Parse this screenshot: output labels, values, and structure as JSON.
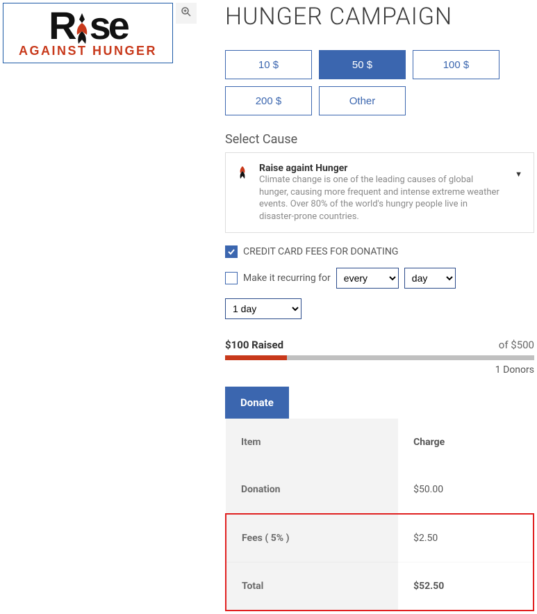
{
  "logo": {
    "word_prefix": "R",
    "word_suffix": "se",
    "tagline": "AGAINST HUNGER"
  },
  "title": "HUNGER CAMPAIGN",
  "amounts": [
    {
      "label": "10 $",
      "selected": false
    },
    {
      "label": "50 $",
      "selected": true
    },
    {
      "label": "100 $",
      "selected": false
    },
    {
      "label": "200 $",
      "selected": false
    },
    {
      "label": "Other",
      "selected": false
    }
  ],
  "cause": {
    "section_label": "Select Cause",
    "title": "Raise againt Hunger",
    "description": "Climate change is one of the leading causes of global hunger, causing more frequent and intense extreme weather events. Over 80% of the world's hungry people live in disaster-prone countries."
  },
  "options": {
    "cc_fees_label": "CREDIT CARD FEES FOR DONATING",
    "cc_fees_checked": true,
    "recurring_label": "Make it recurring for",
    "recurring_checked": false,
    "freq_options": [
      "every"
    ],
    "unit_options": [
      "day"
    ],
    "period_options": [
      "1 day"
    ]
  },
  "progress": {
    "raised_label": "$100 Raised",
    "goal_label": "of $500",
    "percent": 20,
    "donors_label": "1 Donors"
  },
  "tabs": {
    "donate": "Donate"
  },
  "table": {
    "headers": {
      "item": "Item",
      "charge": "Charge"
    },
    "rows": [
      {
        "item": "Donation",
        "charge": "$50.00",
        "highlight": false
      },
      {
        "item": "Fees ( 5% )",
        "charge": "$2.50",
        "highlight": true
      },
      {
        "item": "Total",
        "charge": "$52.50",
        "highlight": true,
        "total": true
      }
    ]
  }
}
